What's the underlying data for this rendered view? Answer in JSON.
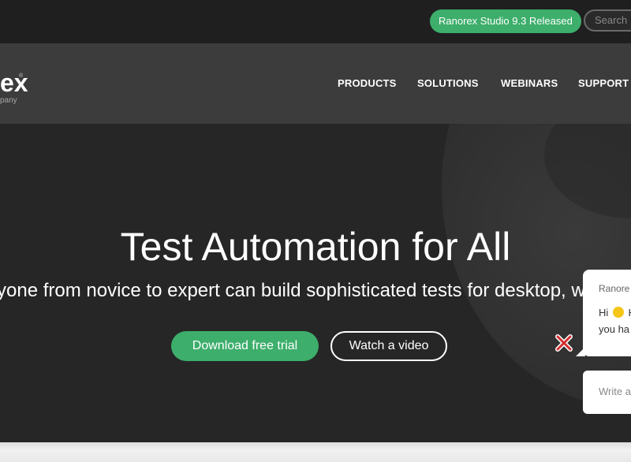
{
  "topbar": {
    "release_label": "Ranorex Studio 9.3 Released",
    "search_placeholder": "Search"
  },
  "logo": {
    "text": "ex",
    "registered": "®",
    "subtext": "pany"
  },
  "nav": {
    "items": [
      {
        "label": "PRODUCTS"
      },
      {
        "label": "SOLUTIONS"
      },
      {
        "label": "WEBINARS"
      },
      {
        "label": "SUPPORT"
      }
    ]
  },
  "hero": {
    "title": "Test Automation for All",
    "subtitle": "yone from novice to expert can build sophisticated tests for desktop, web, a",
    "download_button": "Download free trial",
    "video_button": "Watch a video"
  },
  "chat": {
    "agent_name": "Ranore",
    "greeting_start": "Hi",
    "greeting_end": "H",
    "message_line2": "you ha",
    "input_placeholder": "Write a"
  },
  "colors": {
    "accent_green": "#3dae6b",
    "topbar_bg": "#1f1f1f",
    "navbar_bg": "#3c3c3c",
    "hero_bg": "#262626"
  }
}
